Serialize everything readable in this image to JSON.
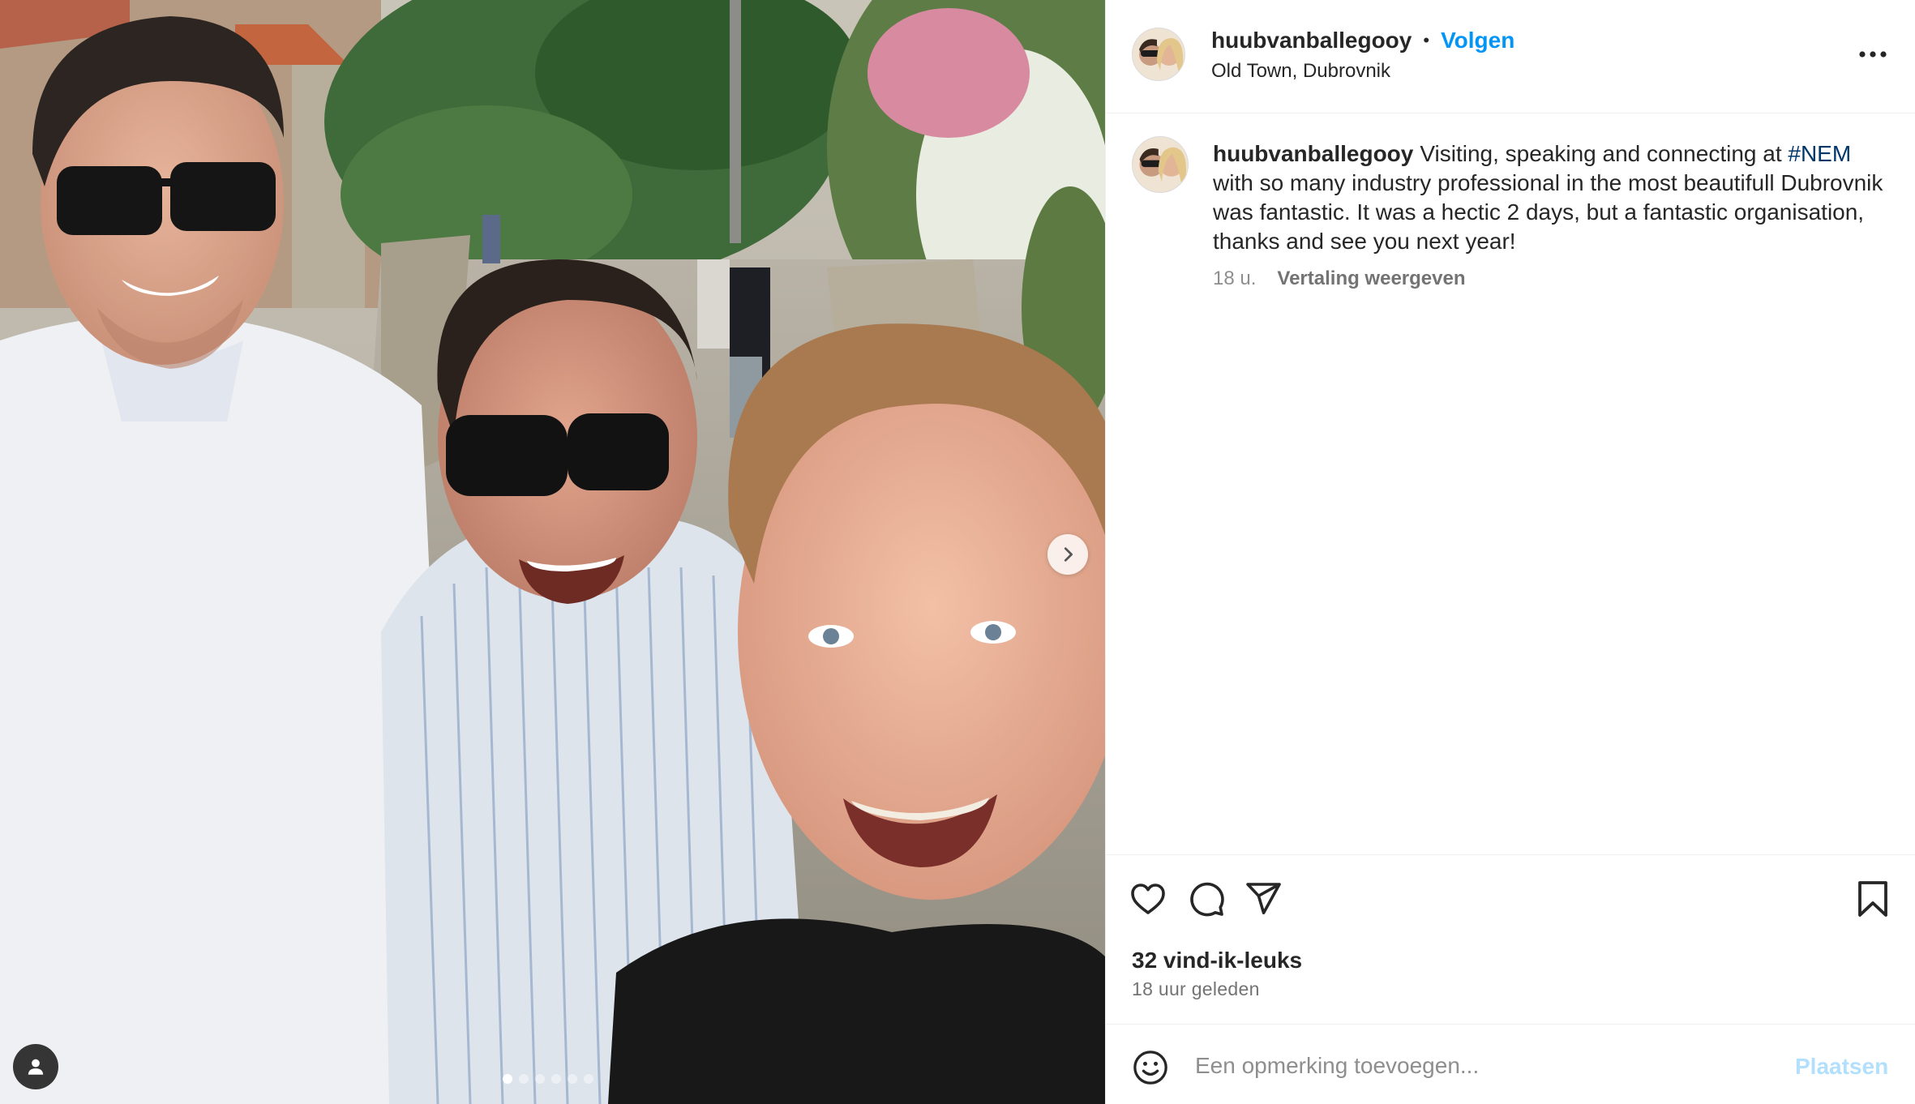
{
  "header": {
    "username": "huubvanballegooy",
    "separator": "•",
    "follow_label": "Volgen",
    "location": "Old Town, Dubrovnik",
    "more_icon": "more-horizontal-icon"
  },
  "caption": {
    "username": "huubvanballegooy",
    "text_before": "Visiting, speaking and connecting at ",
    "hashtag": "#NEM",
    "text_after": " with so many industry professional in the most beautifull Dubrovnik was fantastic. It was a hectic 2 days, but a fantastic organisation, thanks and see you next year!",
    "age": "18 u.",
    "translate_label": "Vertaling weergeven"
  },
  "actions": {
    "like_icon": "heart-icon",
    "comment_icon": "comment-icon",
    "share_icon": "send-icon",
    "save_icon": "bookmark-icon",
    "likes_text": "32 vind-ik-leuks",
    "posted_text": "18 uur geleden"
  },
  "comment_box": {
    "placeholder": "Een opmerking toevoegen...",
    "post_label": "Plaatsen"
  },
  "media": {
    "carousel_count": 6,
    "carousel_active": 1,
    "next_icon": "chevron-right-icon",
    "tag_icon": "user-tag-icon"
  },
  "colors": {
    "accent": "#0095f6",
    "hashtag": "#00376b",
    "post_disabled": "#b2dffc",
    "muted": "#8e8e8e",
    "border": "#efefef"
  }
}
